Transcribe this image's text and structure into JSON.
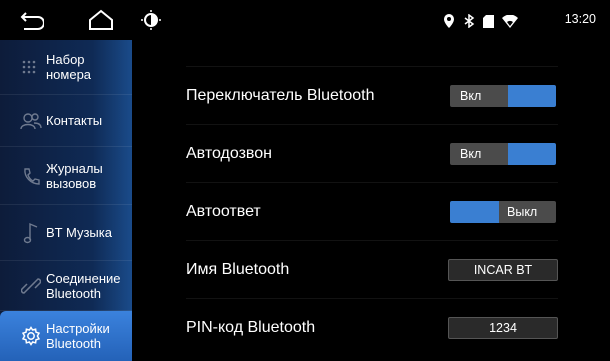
{
  "status": {
    "time": "13:20",
    "icons": [
      "location-icon",
      "bluetooth-icon",
      "sd-card-icon",
      "wifi-icon"
    ]
  },
  "sidebar": {
    "items": [
      {
        "label": "Набор\nномера",
        "icon": "dialpad-icon",
        "active": false
      },
      {
        "label": "Контакты",
        "icon": "contacts-icon",
        "active": false
      },
      {
        "label": "Журналы\nвызовов",
        "icon": "call-log-icon",
        "active": false
      },
      {
        "label": "BT Музыка",
        "icon": "music-icon",
        "active": false
      },
      {
        "label": "Соединение\nBluetooth",
        "icon": "link-icon",
        "active": false
      },
      {
        "label": "Настройки\nBluetooth",
        "icon": "settings-icon",
        "active": true
      }
    ]
  },
  "settings": {
    "bt_switch": {
      "title": "Переключатель Bluetooth",
      "state": "Вкл"
    },
    "auto_connect": {
      "title": "Автодозвон",
      "state": "Вкл"
    },
    "auto_answer": {
      "title": "Автоответ",
      "state": "Выкл"
    },
    "bt_name": {
      "title": "Имя Bluetooth",
      "value": "INCAR BT"
    },
    "bt_pin": {
      "title": "PIN-код Bluetooth",
      "value": "1234"
    }
  },
  "colors": {
    "accent": "#3a7fd2",
    "toggle_off": "#4b4b4b",
    "sidebar_active": "#2f72cc"
  }
}
